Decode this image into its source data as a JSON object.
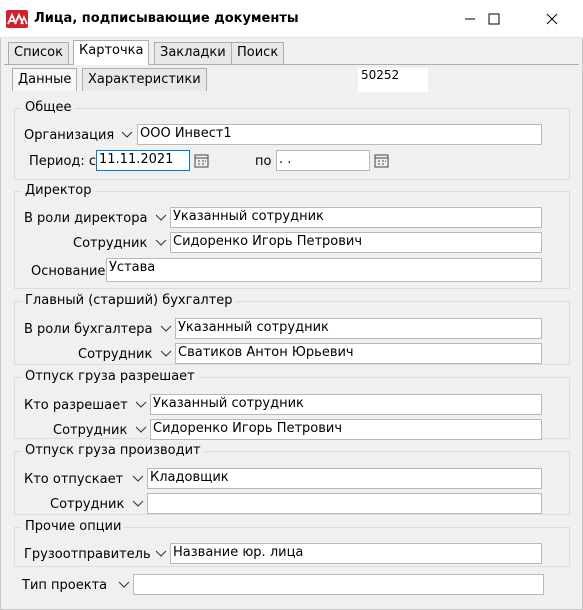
{
  "window": {
    "title": "Лица, подписывающие документы"
  },
  "tabs": [
    {
      "label": "Список",
      "active": false
    },
    {
      "label": "Карточка",
      "active": true
    },
    {
      "label": "Закладки",
      "active": false
    },
    {
      "label": "Поиск",
      "active": false
    }
  ],
  "subtabs": [
    {
      "label": "Данные",
      "active": true
    },
    {
      "label": "Характеристики",
      "active": false
    }
  ],
  "record_id": "50252",
  "general": {
    "legend": "Общее",
    "org_label": "Организация",
    "org_value": "ООО Инвест1",
    "period_label": "Период: с",
    "period_from": "11.11.2021",
    "period_to_label": "по",
    "period_to": " . ."
  },
  "director": {
    "legend": "Директор",
    "role_label": "В роли директора",
    "role_value": "Указанный сотрудник",
    "employee_label": "Сотрудник",
    "employee_value": "Сидоренко Игорь Петрович",
    "basis_label": "Основание",
    "basis_value": "Устава"
  },
  "accountant": {
    "legend": "Главный (старший) бухгалтер",
    "role_label": "В роли бухгалтера",
    "role_value": "Указанный сотрудник",
    "employee_label": "Сотрудник",
    "employee_value": "Сватиков Антон Юрьевич"
  },
  "release_permit": {
    "legend": "Отпуск груза разрешает",
    "who_label": "Кто разрешает",
    "who_value": "Указанный сотрудник",
    "employee_label": "Сотрудник",
    "employee_value": "Сидоренко Игорь Петрович"
  },
  "release_exec": {
    "legend": "Отпуск груза производит",
    "who_label": "Кто отпускает",
    "who_value": "Кладовщик",
    "employee_label": "Сотрудник",
    "employee_value": ""
  },
  "other": {
    "legend": "Прочие опции",
    "shipper_label": "Грузоотправитель",
    "shipper_value": "Название юр. лица"
  },
  "project": {
    "label": "Тип проекта",
    "value": ""
  },
  "colors": {
    "accent": "#0078d7",
    "app_icon": "#d4202b"
  },
  "icons": {
    "app": "app-logo-icon",
    "minimize": "minimize-icon",
    "maximize": "maximize-icon",
    "close": "close-icon",
    "dropdown": "chevron-down-icon",
    "calendar": "calendar-icon"
  }
}
